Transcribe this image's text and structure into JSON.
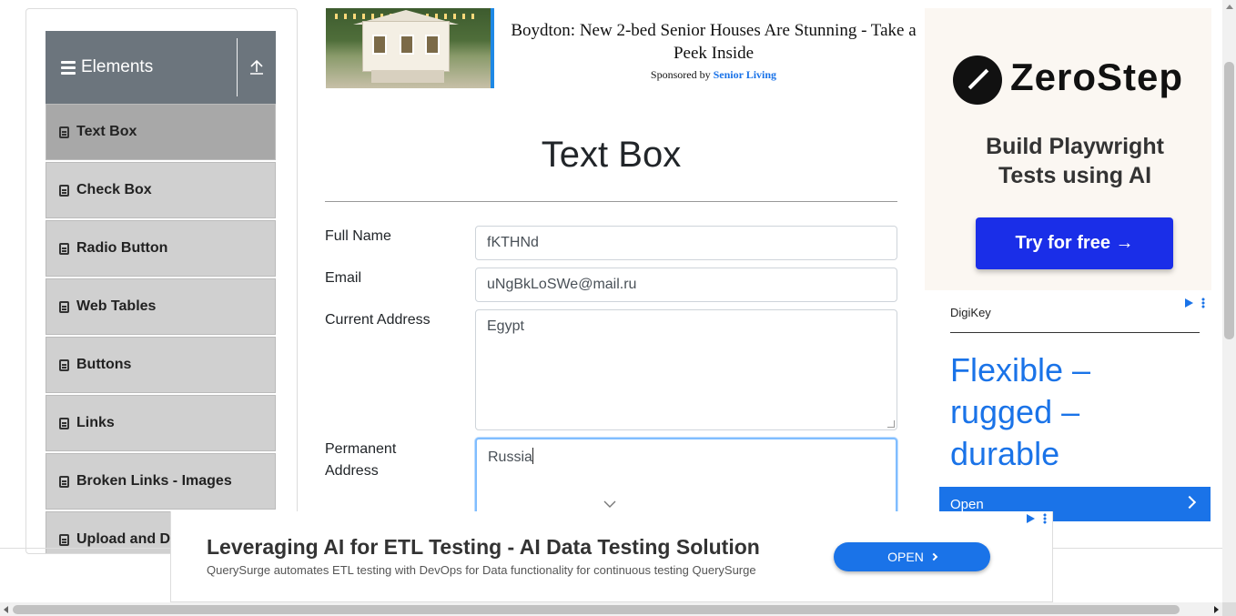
{
  "sidebar": {
    "group_title": "Elements",
    "items": [
      {
        "label": "Text Box",
        "active": true
      },
      {
        "label": "Check Box"
      },
      {
        "label": "Radio Button"
      },
      {
        "label": "Web Tables"
      },
      {
        "label": "Buttons"
      },
      {
        "label": "Links"
      },
      {
        "label": "Broken Links - Images"
      },
      {
        "label": "Upload and D"
      }
    ]
  },
  "ad_top": {
    "headline": "Boydton: New 2-bed Senior Houses Are Stunning - Take a Peek Inside",
    "sponsor_prefix": "Sponsored by",
    "sponsor_name": "Senior Living"
  },
  "main": {
    "title": "Text Box",
    "full_name_label": "Full Name",
    "full_name_value": "fKTHNd",
    "email_label": "Email",
    "email_value": "uNgBkLoSWe@mail.ru",
    "current_address_label": "Current Address",
    "current_address_value": "Egypt",
    "permanent_address_label_1": "Permanent",
    "permanent_address_label_2": "Address",
    "permanent_address_value": "Russia"
  },
  "ad_right": {
    "brand": "ZeroStep",
    "tagline_1": "Build Playwright",
    "tagline_2": "Tests using AI",
    "button": "Try for free →"
  },
  "ad_digikey": {
    "brand": "DigiKey",
    "headline_1": "Flexible –",
    "headline_2": "rugged –",
    "headline_3": "durable",
    "open": "Open"
  },
  "ad_bottom": {
    "headline": "Leveraging AI for ETL Testing - AI Data Testing Solution",
    "body": "QuerySurge automates ETL testing with DevOps for Data functionality for continuous testing QuerySurge",
    "button": "OPEN"
  },
  "colors": {
    "accent": "#1a73e8",
    "sidebar_header": "#6c757d",
    "zerostep_button": "#1a2ee8"
  }
}
